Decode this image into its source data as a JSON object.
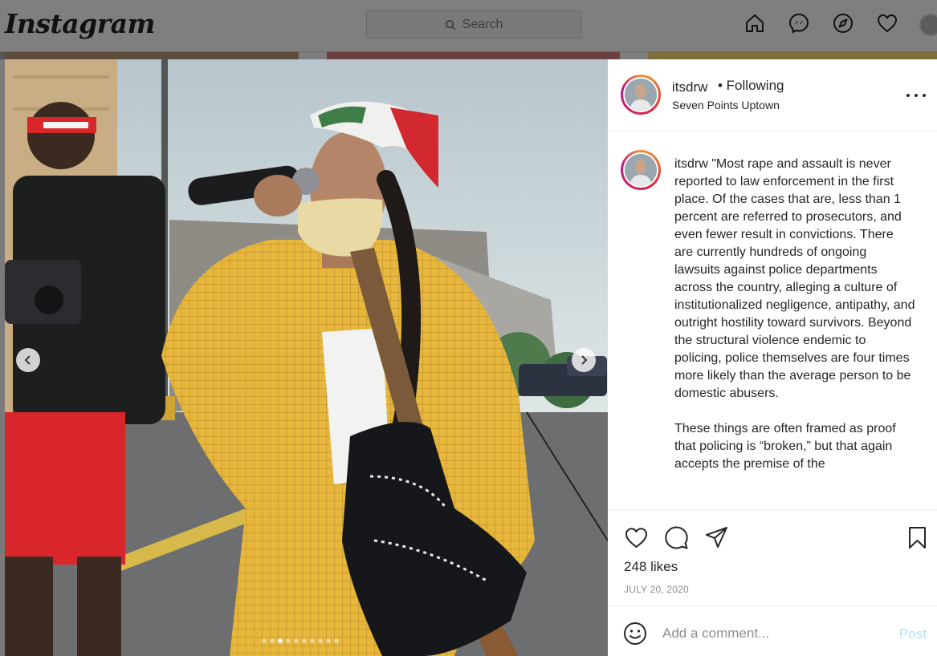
{
  "nav": {
    "logo": "Instagram",
    "search_placeholder": "Search",
    "icons": [
      "home-icon",
      "messenger-icon",
      "explore-icon",
      "activity-heart-icon",
      "profile-avatar"
    ]
  },
  "post": {
    "username": "itsdrw",
    "following_label": "• Following",
    "location": "Seven Points Uptown",
    "caption_user": "itsdrw",
    "caption_paragraphs": [
      "\"Most rape and assault is never reported to law enforcement in the first place. Of the cases that are, less than 1 percent are referred to prosecutors, and even fewer result in convictions. There are currently hundreds of ongoing lawsuits against police departments across the country, alleging a culture of institutionalized negligence, antipathy, and outright hostility toward survivors. Beyond the structural violence endemic to policing, police themselves are four times more likely than the average person to be domestic abusers.",
      "These things are often framed as proof that policing is “broken,” but that again accepts the premise of the"
    ],
    "likes": "248 likes",
    "date": "JULY 20, 2020",
    "carousel": {
      "count": 10,
      "active_index": 2
    }
  },
  "comment": {
    "placeholder": "Add a comment...",
    "post_label": "Post"
  },
  "colors": {
    "post_button_disabled": "#b2dffc",
    "overlay": "#7f7f7f",
    "jacket_yellow": "#e8b93a"
  }
}
